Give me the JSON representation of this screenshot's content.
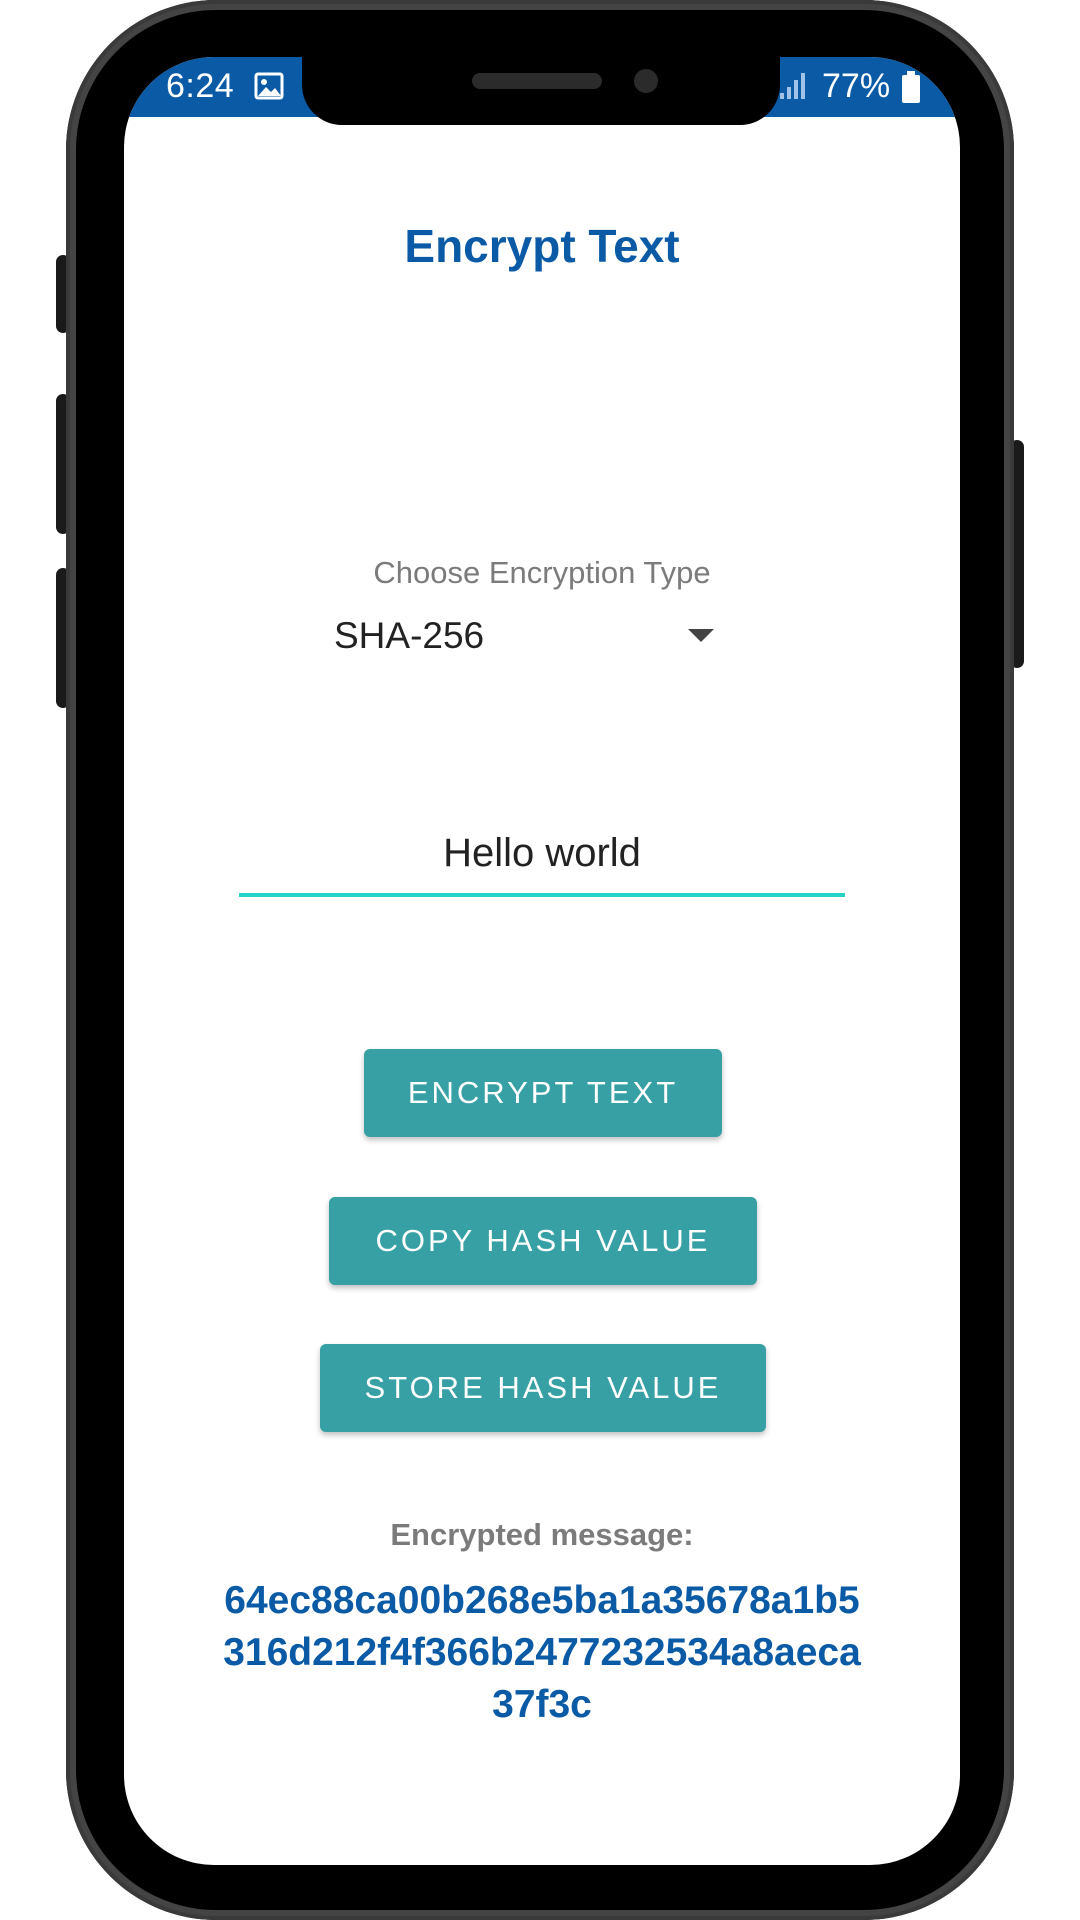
{
  "status_bar": {
    "time": "6:24",
    "battery_percent": "77%",
    "bar_color": "#0a5aa6"
  },
  "icons": {
    "gallery": "image-icon",
    "signal": "signal-icon",
    "battery": "battery-icon",
    "dropdown": "chevron-down-icon"
  },
  "page": {
    "title": "Encrypt Text"
  },
  "encryption_select": {
    "label": "Choose Encryption Type",
    "value": "SHA-256"
  },
  "text_input": {
    "value": "Hello world"
  },
  "buttons": {
    "encrypt": "ENCRYPT TEXT",
    "copy": "COPY HASH VALUE",
    "store": "STORE HASH VALUE"
  },
  "result": {
    "label": "Encrypted message:",
    "hash": "64ec88ca00b268e5ba1a35678a1b5316d212f4f366b2477232534a8aeca37f3c"
  },
  "colors": {
    "title_blue": "#0a5aa6",
    "button_teal": "#36a0a5",
    "input_underline": "#26d3c6",
    "label_gray": "#7b7b7b"
  }
}
